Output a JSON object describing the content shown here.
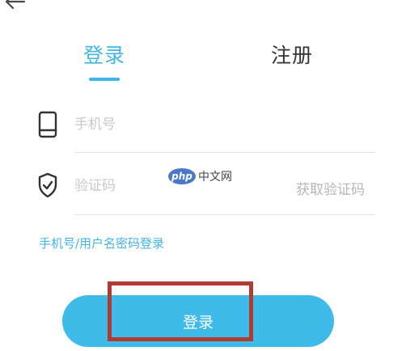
{
  "tabs": {
    "login": "登录",
    "register": "注册"
  },
  "form": {
    "phone_placeholder": "手机号",
    "code_placeholder": "验证码",
    "get_code": "获取验证码",
    "alt_login": "手机号/用户名密码登录",
    "submit": "登录"
  },
  "watermark": {
    "logo": "php",
    "text": "中文网"
  },
  "icons": {
    "back": "arrow-left-icon",
    "phone": "phone-icon",
    "shield": "shield-check-icon"
  },
  "colors": {
    "accent": "#3fb6e6",
    "button": "#3fbbea",
    "highlight": "#b23a30"
  }
}
